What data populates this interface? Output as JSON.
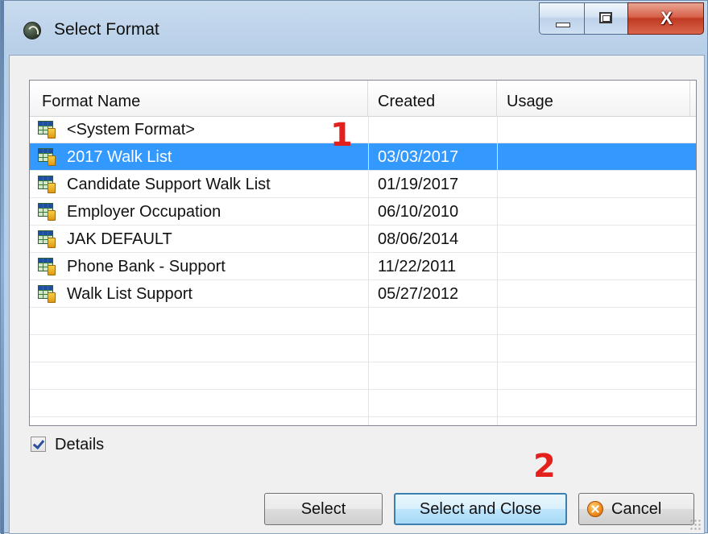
{
  "window": {
    "title": "Select Format",
    "app_icon": "app-logo-icon",
    "controls": {
      "minimize": "minimize-icon",
      "maximize": "maximize-icon",
      "close": "close-icon",
      "close_glyph": "X"
    }
  },
  "list": {
    "columns": [
      "Format Name",
      "Created",
      "Usage"
    ],
    "rows": [
      {
        "name": "<System Format>",
        "created": "",
        "usage": "",
        "selected": false
      },
      {
        "name": "2017 Walk List",
        "created": "03/03/2017",
        "usage": "",
        "selected": true
      },
      {
        "name": "Candidate Support Walk List",
        "created": "01/19/2017",
        "usage": "",
        "selected": false
      },
      {
        "name": "Employer Occupation",
        "created": "06/10/2010",
        "usage": "",
        "selected": false
      },
      {
        "name": "JAK DEFAULT",
        "created": "08/06/2014",
        "usage": "",
        "selected": false
      },
      {
        "name": "Phone Bank - Support",
        "created": "11/22/2011",
        "usage": "",
        "selected": false
      },
      {
        "name": "Walk List Support",
        "created": "05/27/2012",
        "usage": "",
        "selected": false
      }
    ],
    "row_icon": "format-table-icon"
  },
  "details": {
    "label": "Details",
    "checked": true
  },
  "buttons": {
    "select": "Select",
    "select_close": "Select and Close",
    "cancel": "Cancel"
  },
  "annotations": {
    "one": "1",
    "two": "2",
    "color": "#e3201b"
  },
  "colors": {
    "selection": "#3399ff"
  }
}
